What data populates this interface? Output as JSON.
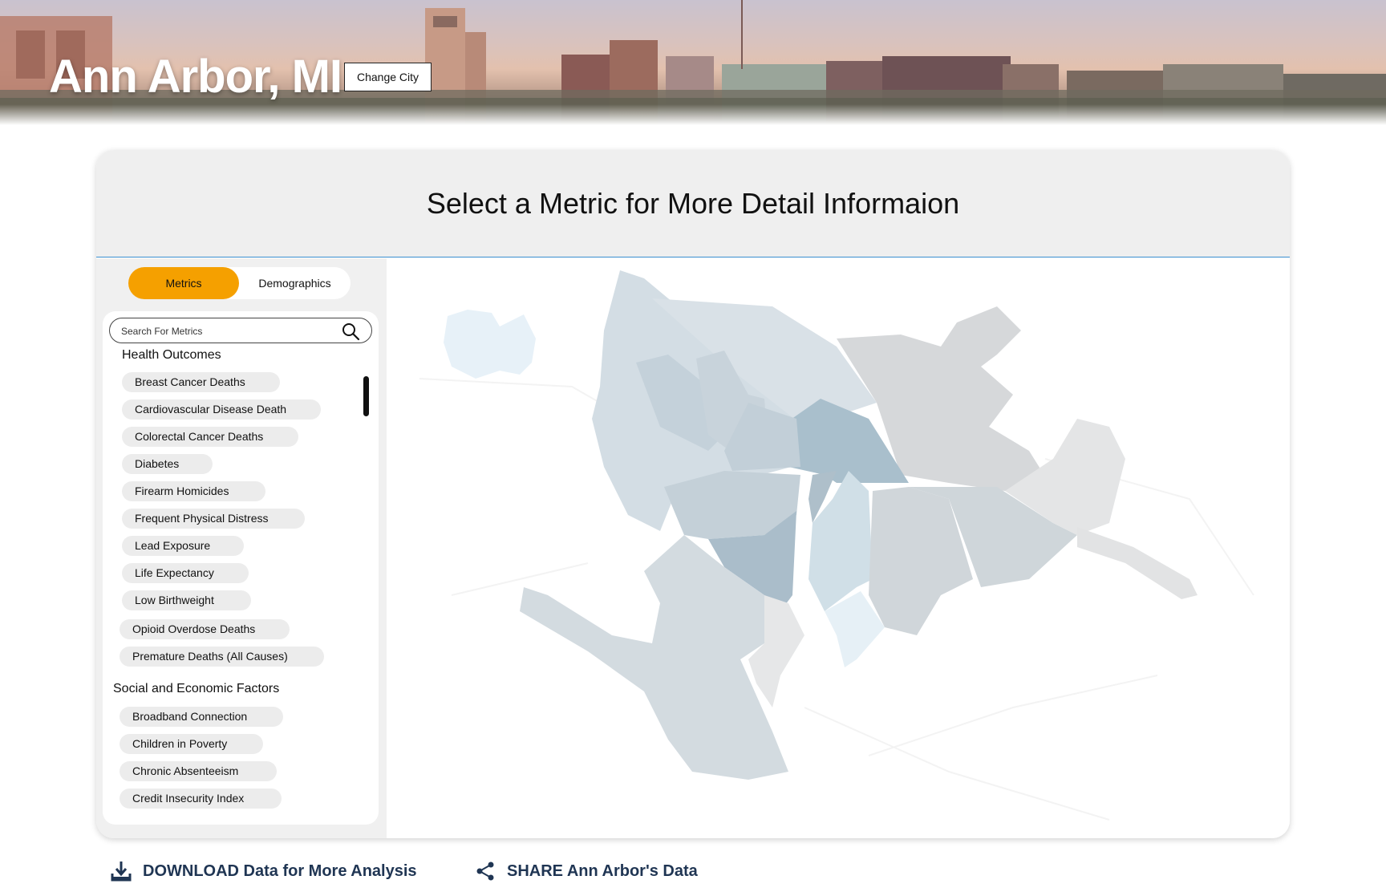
{
  "header": {
    "city_title": "Ann Arbor, MI",
    "change_city_label": "Change City"
  },
  "card": {
    "title": "Select a Metric for More Detail Informaion"
  },
  "toggle": {
    "metrics_label": "Metrics",
    "demographics_label": "Demographics",
    "active": "Metrics",
    "active_color": "#f5a000"
  },
  "search": {
    "placeholder": "Search For Metrics"
  },
  "sections": [
    {
      "title": "Health Outcomes",
      "items": [
        "Breast Cancer Deaths",
        "Cardiovascular Disease Death",
        "Colorectal Cancer Deaths",
        "Diabetes",
        "Firearm Homicides",
        "Frequent Physical Distress",
        "Lead Exposure",
        "Life Expectancy",
        "Low Birthweight",
        "Opioid Overdose Deaths",
        "Premature Deaths (All Causes)"
      ]
    },
    {
      "title": "Social and Economic Factors",
      "items": [
        "Broadband Connection",
        "Children in Poverty",
        "Chronic Absenteeism",
        "Credit Insecurity Index"
      ]
    }
  ],
  "footer": {
    "download_label": "DOWNLOAD Data for More Analysis",
    "share_label": "SHARE Ann Arbor's Data"
  },
  "colors": {
    "accent": "#f5a000",
    "footer_text": "#1f3553",
    "divider": "#3a8fd0"
  },
  "icons": {
    "search": "search-icon",
    "download": "download-icon",
    "share": "share-icon"
  }
}
